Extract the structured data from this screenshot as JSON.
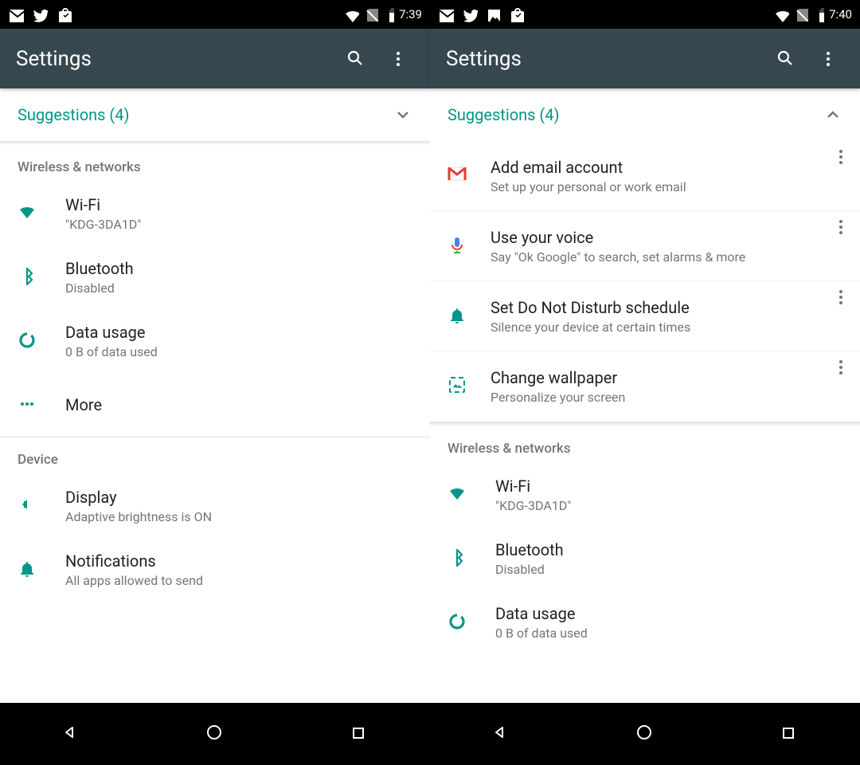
{
  "left": {
    "status_time": "7:39",
    "app_title": "Settings",
    "suggestions": {
      "label": "Suggestions (4)"
    },
    "sections": {
      "wireless_header": "Wireless & networks",
      "device_header": "Device"
    },
    "wifi": {
      "title": "Wi-Fi",
      "sub": "\"KDG-3DA1D\""
    },
    "bt": {
      "title": "Bluetooth",
      "sub": "Disabled"
    },
    "data": {
      "title": "Data usage",
      "sub": "0 B of data used"
    },
    "more": {
      "title": "More"
    },
    "display": {
      "title": "Display",
      "sub": "Adaptive brightness is ON"
    },
    "notif": {
      "title": "Notifications",
      "sub": "All apps allowed to send"
    }
  },
  "right": {
    "status_time": "7:40",
    "app_title": "Settings",
    "suggestions": {
      "label": "Suggestions (4)"
    },
    "sugg_items": {
      "email": {
        "title": "Add email account",
        "sub": "Set up your personal or work email"
      },
      "voice": {
        "title": "Use your voice",
        "sub": "Say \"Ok Google\" to search, set alarms & more"
      },
      "dnd": {
        "title": "Set Do Not Disturb schedule",
        "sub": "Silence your device at certain times"
      },
      "wall": {
        "title": "Change wallpaper",
        "sub": "Personalize your screen"
      }
    },
    "sections": {
      "wireless_header": "Wireless & networks"
    },
    "wifi": {
      "title": "Wi-Fi",
      "sub": "\"KDG-3DA1D\""
    },
    "bt": {
      "title": "Bluetooth",
      "sub": "Disabled"
    },
    "data": {
      "title": "Data usage",
      "sub": "0 B of data used"
    }
  }
}
